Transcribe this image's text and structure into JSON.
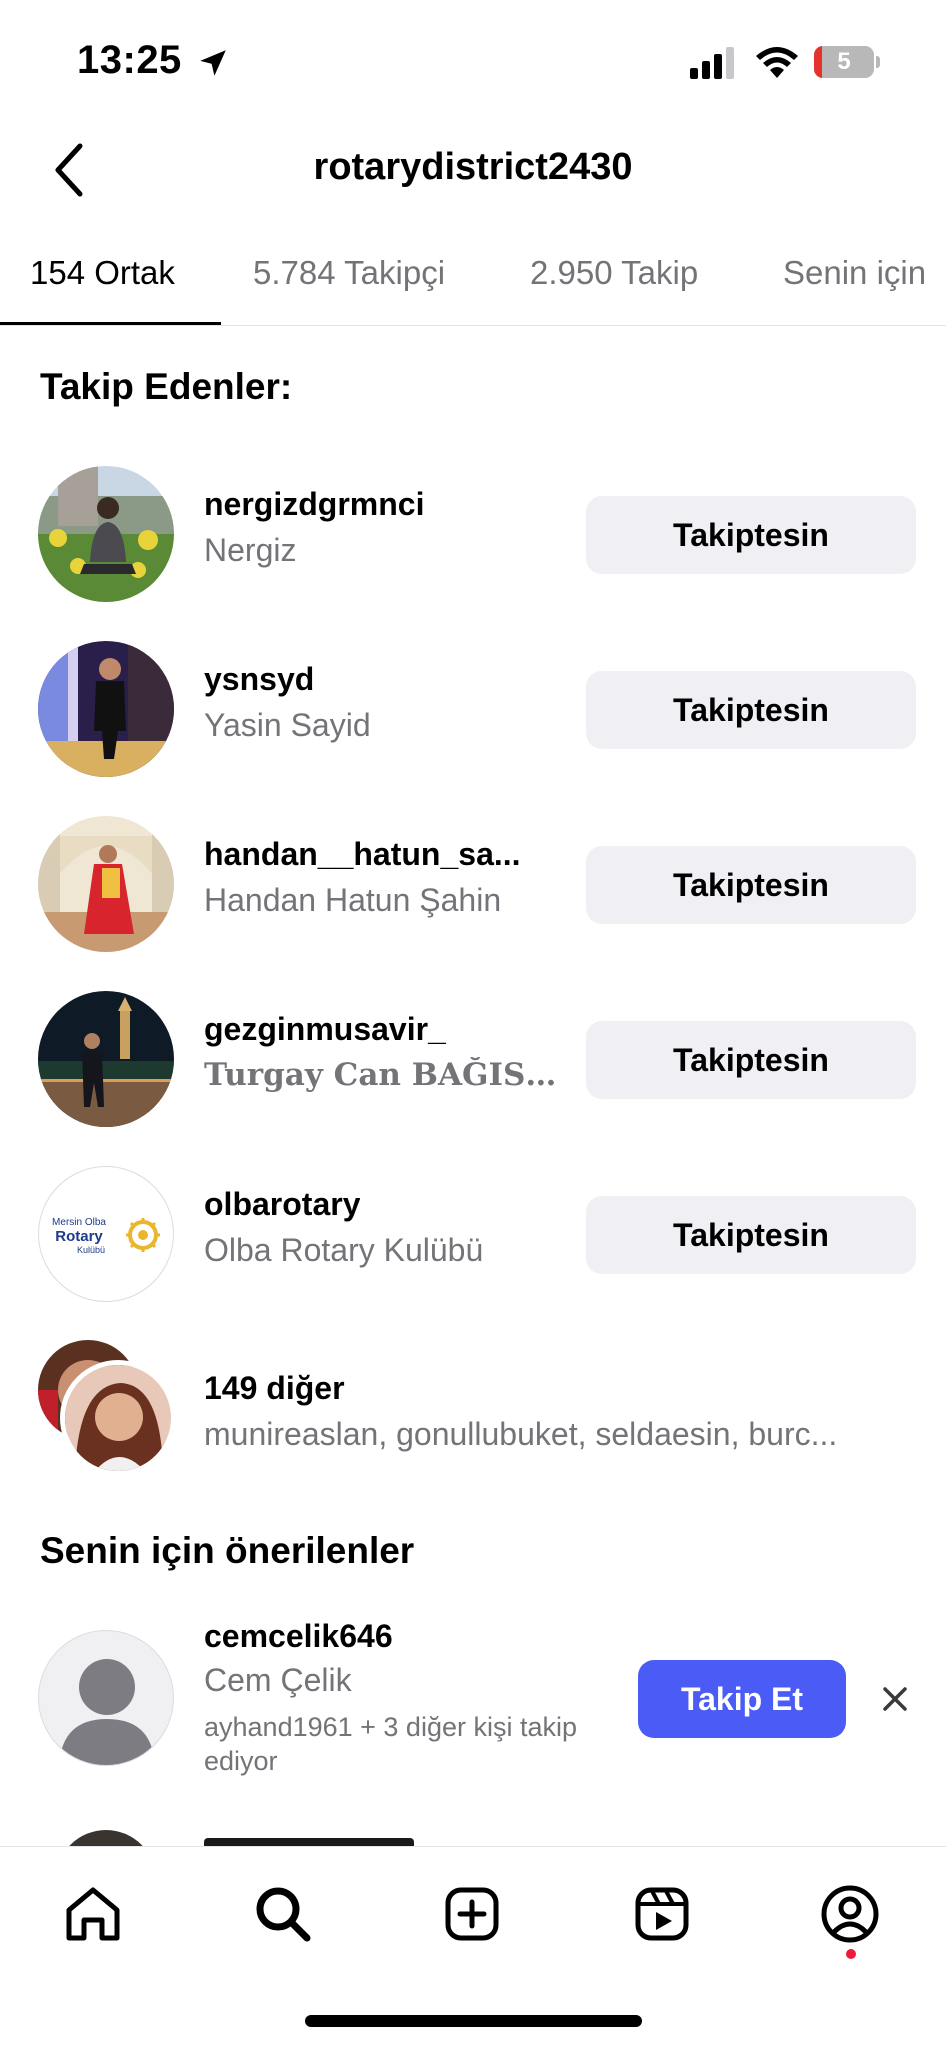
{
  "status_bar": {
    "time": "13:25",
    "battery_level": "5",
    "icons": [
      "location-arrow-icon",
      "cellular-signal-icon",
      "wifi-icon",
      "battery-icon"
    ]
  },
  "header": {
    "title": "rotarydistrict2430",
    "back_icon": "chevron-left-icon"
  },
  "tabs": [
    {
      "label": "154 Ortak",
      "active": true
    },
    {
      "label": "5.784 Takipçi",
      "active": false
    },
    {
      "label": "2.950 Takip",
      "active": false
    },
    {
      "label": "Senin için",
      "active": false
    }
  ],
  "followers_section": {
    "title": "Takip Edenler:",
    "users": [
      {
        "username": "nergizdgrmnci",
        "name": "Nergiz",
        "button": "Takiptesin"
      },
      {
        "username": "ysnsyd",
        "name": "Yasin Sayid",
        "button": "Takiptesin"
      },
      {
        "username": "handan__hatun_sa...",
        "name": "Handan Hatun Şahin",
        "button": "Takiptesin"
      },
      {
        "username": "gezginmusavir_",
        "name": "Turgay Can BAĞISL...",
        "button": "Takiptesin"
      },
      {
        "username": "olbarotary",
        "name": "Olba Rotary Kulübü",
        "button": "Takiptesin",
        "avatar_text": {
          "line1": "Mersin Olba",
          "line2": "Rotary",
          "line3": "Kulübü"
        }
      }
    ],
    "more": {
      "count_label": "149 diğer",
      "names": "munireaslan, gonullubuket, seldaesin, burc..."
    }
  },
  "suggested_section": {
    "title": "Senin için önerilenler",
    "users": [
      {
        "username": "cemcelik646",
        "name": "Cem Çelik",
        "note": "ayhand1961 + 3 diğer kişi takip ediyor",
        "button": "Takip Et",
        "dismiss_icon": "close-icon"
      }
    ]
  },
  "bottom_nav": {
    "items": [
      "home-icon",
      "search-icon",
      "create-post-icon",
      "reels-icon",
      "profile-icon"
    ],
    "active": "search-icon"
  },
  "colors": {
    "primary_button": "#4a5cf5",
    "secondary_button": "#efeff4",
    "muted_text": "#737378",
    "notification_dot": "#ed1a3a"
  }
}
